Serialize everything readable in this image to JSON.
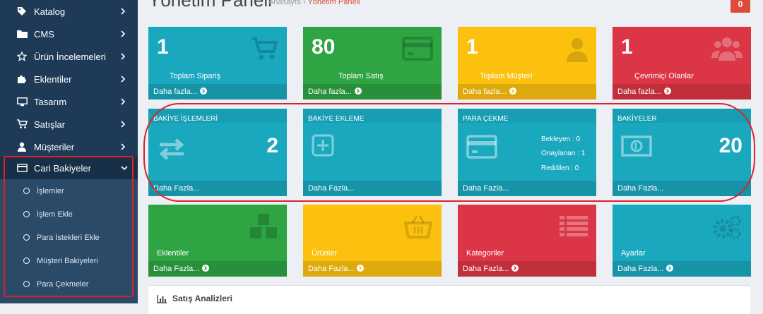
{
  "header": {
    "title": "Yönetim Paneli",
    "breadcrumb_home": "Anasayfa",
    "breadcrumb_sep": "›",
    "breadcrumb_current": "Yönetim Paneli",
    "button_label": "0"
  },
  "sidebar": {
    "items": [
      {
        "label": "Katalog",
        "icon": "tag-icon"
      },
      {
        "label": "CMS",
        "icon": "folder-icon"
      },
      {
        "label": "Ürün İncelemeleri",
        "icon": "star-icon"
      },
      {
        "label": "Eklentiler",
        "icon": "puzzle-icon"
      },
      {
        "label": "Tasarım",
        "icon": "desktop-icon"
      },
      {
        "label": "Satışlar",
        "icon": "cart-icon"
      },
      {
        "label": "Müşteriler",
        "icon": "user-icon"
      },
      {
        "label": "Cari Bakiyeler",
        "icon": "credit-card-icon"
      }
    ],
    "submenu": [
      "İşlemler",
      "İşlem Ekle",
      "Para İstekleri Ekle",
      "Müşteri Bakiyeleri",
      "Para Çekmeler"
    ]
  },
  "stats": [
    {
      "number": "1",
      "label": "Toplam Sipariş",
      "footer": "Daha fazla...",
      "color": "#1aa8bf",
      "icon": "shopping-cart-icon"
    },
    {
      "number": "80",
      "label": "Toplam Satış",
      "footer": "Daha fazla...",
      "color": "#2ea443",
      "icon": "credit-card-icon"
    },
    {
      "number": "1",
      "label": "Toplam Müşteri",
      "footer": "Daha fazla...",
      "color": "#fcc10e",
      "icon": "user-icon"
    },
    {
      "number": "1",
      "label": "Çevrimiçi Olanlar",
      "footer": "Daha fazla...",
      "color": "#dc3545",
      "icon": "users-icon"
    }
  ],
  "balance": [
    {
      "title": "BAKİYE İŞLEMLERİ",
      "value": "2",
      "footer": "Daha Fazla...",
      "icon": "exchange-icon"
    },
    {
      "title": "BAKİYE EKLEME",
      "value": "",
      "footer": "Daha Fazla...",
      "icon": "plus-square-icon"
    },
    {
      "title": "PARA ÇEKME",
      "value": "",
      "footer": "Daha Fazla...",
      "icon": "credit-card-icon",
      "stats": [
        "Bekleyen : 0",
        "Onaylanan : 1",
        "Reddilen : 0"
      ]
    },
    {
      "title": "BAKİYELER",
      "value": "20",
      "footer": "Daha Fazla...",
      "icon": "money-icon"
    }
  ],
  "shortcuts": [
    {
      "label": "Eklentiler",
      "footer": "Daha Fazla...",
      "color": "#2ea443",
      "icon": "cubes-icon"
    },
    {
      "label": "Ürünler",
      "footer": "Daha Fazla...",
      "color": "#fcc10e",
      "icon": "basket-icon"
    },
    {
      "label": "Kategoriler",
      "footer": "Daha Fazla...",
      "color": "#dc3545",
      "icon": "list-icon"
    },
    {
      "label": "Ayarlar",
      "footer": "Daha Fazla...",
      "color": "#1aa8bf",
      "icon": "cogs-icon"
    }
  ],
  "analytics": {
    "title": "Satış Analizleri",
    "icon": "bar-chart-icon"
  },
  "colors": {
    "sidebar": "#1e3a57",
    "teal": "#1aa8bf",
    "highlight": "#e0202a"
  }
}
